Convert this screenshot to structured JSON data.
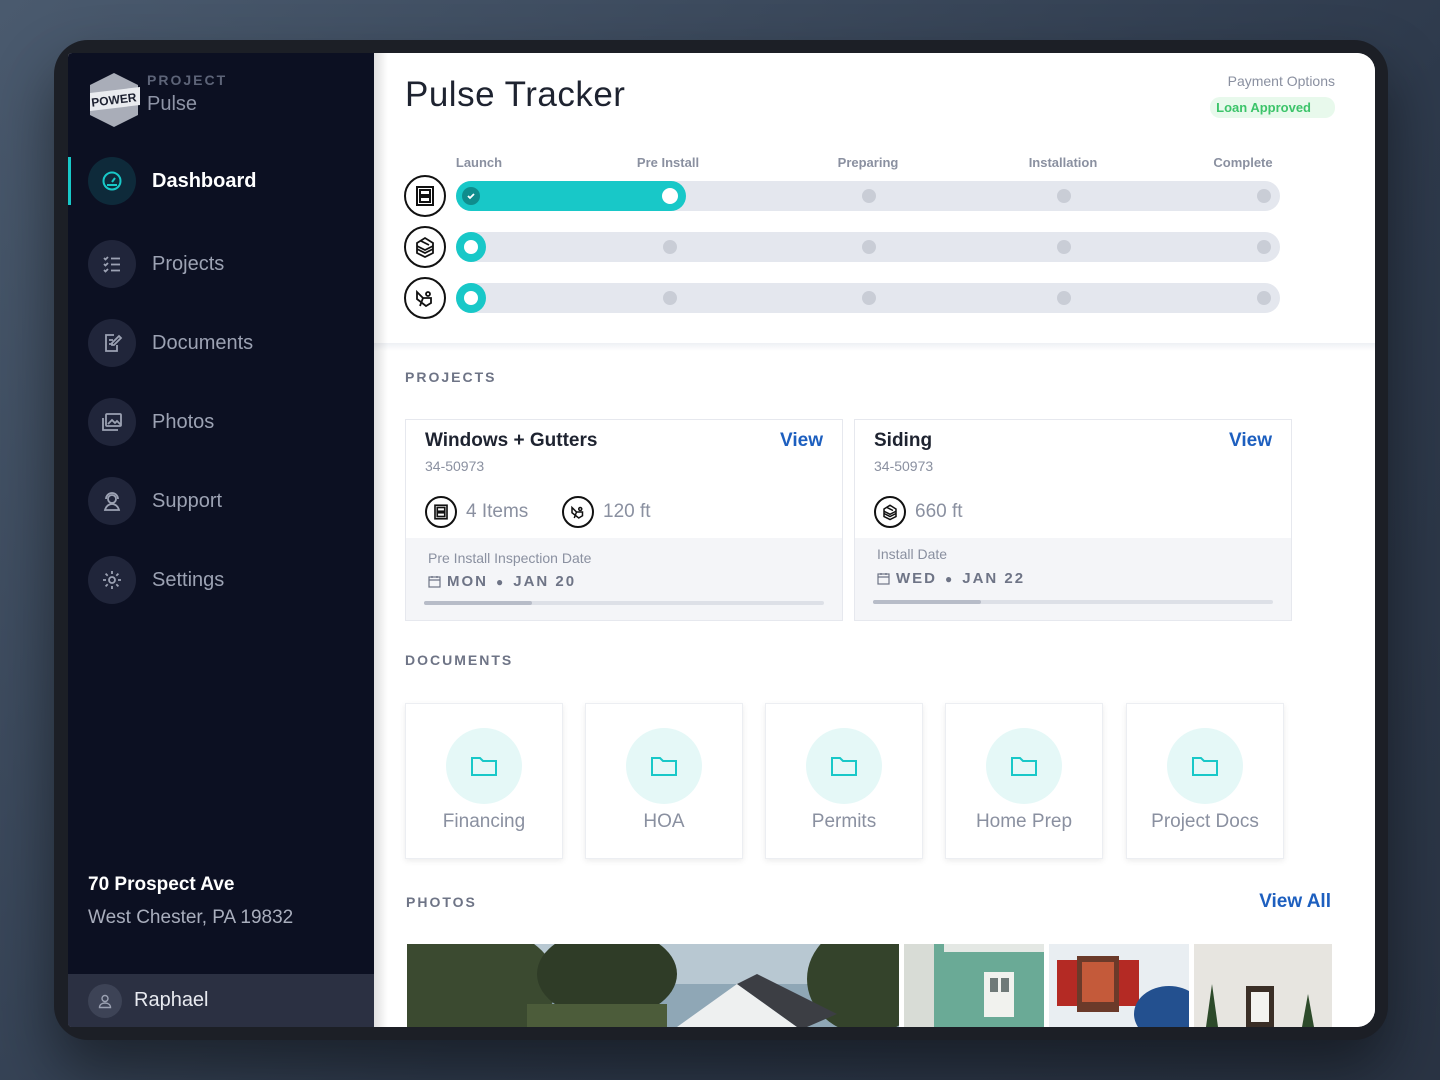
{
  "brand": {
    "kicker": "PROJECT",
    "name": "Pulse",
    "logo_text": "POWER"
  },
  "nav": [
    {
      "label": "Dashboard",
      "icon": "dashboard-gauge-icon",
      "active": true
    },
    {
      "label": "Projects",
      "icon": "checklist-icon",
      "active": false
    },
    {
      "label": "Documents",
      "icon": "document-edit-icon",
      "active": false
    },
    {
      "label": "Photos",
      "icon": "photo-gallery-icon",
      "active": false
    },
    {
      "label": "Support",
      "icon": "support-agent-icon",
      "active": false
    },
    {
      "label": "Settings",
      "icon": "gear-icon",
      "active": false
    }
  ],
  "address": {
    "line1": "70 Prospect Ave",
    "line2": "West Chester, PA 19832"
  },
  "user": {
    "name": "Raphael",
    "icon": "user-icon"
  },
  "header": {
    "title": "Pulse Tracker",
    "payment_label": "Payment Options",
    "loan_status": "Loan Approved"
  },
  "tracker": {
    "stages": [
      "Launch",
      "Pre Install",
      "Preparing",
      "Installation",
      "Complete"
    ],
    "rows": [
      {
        "icon": "window-icon",
        "completed_stage_index": 1
      },
      {
        "icon": "siding-icon",
        "completed_stage_index": 0
      },
      {
        "icon": "gutter-icon",
        "completed_stage_index": 0
      }
    ]
  },
  "projects": {
    "heading": "PROJECTS",
    "items": [
      {
        "title": "Windows + Gutters",
        "view_label": "View",
        "id": "34-50973",
        "stats": [
          {
            "icon": "window-icon",
            "text": "4 Items"
          },
          {
            "icon": "gutter-icon",
            "text": "120 ft"
          }
        ],
        "date_label": "Pre Install Inspection Date",
        "day": "MON",
        "date": "JAN 20",
        "progress": 0.27
      },
      {
        "title": "Siding",
        "view_label": "View",
        "id": "34-50973",
        "stats": [
          {
            "icon": "siding-icon",
            "text": "660 ft"
          }
        ],
        "date_label": "Install Date",
        "day": "WED",
        "date": "JAN 22",
        "progress": 0.27
      }
    ]
  },
  "documents": {
    "heading": "DOCUMENTS",
    "folders": [
      "Financing",
      "HOA",
      "Permits",
      "Home Prep",
      "Project Docs"
    ]
  },
  "photos": {
    "heading": "PHOTOS",
    "view_all_label": "View All"
  },
  "colors": {
    "accent": "#18c8c8",
    "link": "#1d5fbf",
    "sidebar": "#0c1022",
    "approved": "#3cc46a"
  }
}
